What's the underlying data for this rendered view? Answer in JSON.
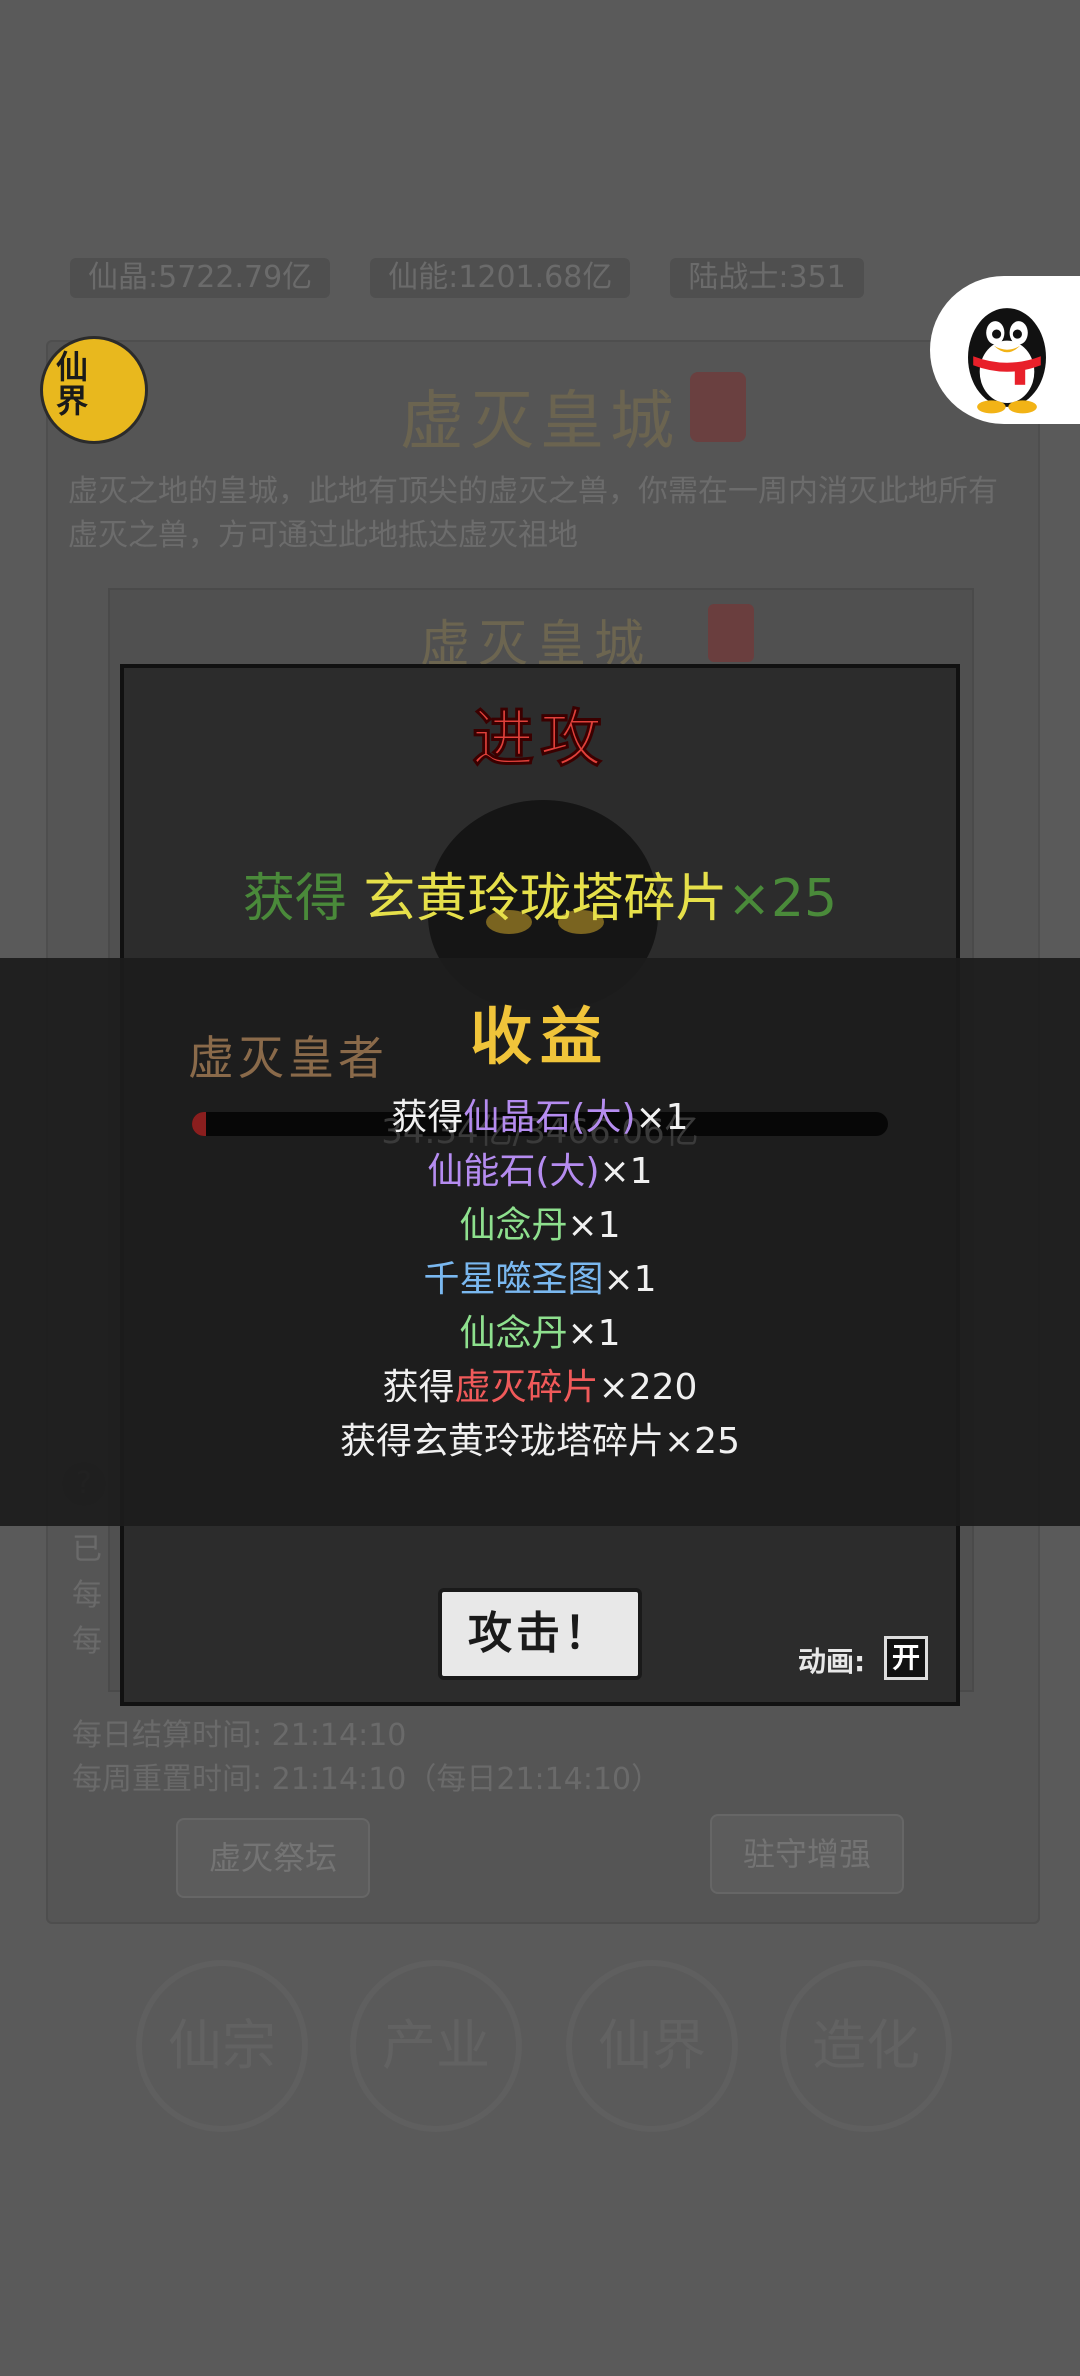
{
  "resources": [
    "仙晶:5722.79亿",
    "仙能:1201.68亿",
    "陆战士:351"
  ],
  "background": {
    "title": "虚灭皇城",
    "description": "虚灭之地的皇城，此地有顶尖的虚灭之兽，你需在一周内消灭此地所有虚灭之兽，方可通过此地抵达虚灭祖地",
    "inner_title": "虚灭皇城",
    "boss_name": "虚灭皇者",
    "boss_hp_text": "34.34亿/3466.06亿",
    "notes": [
      "已",
      "每",
      "每"
    ],
    "daily_settle": "每日结算时间: 21:14:10",
    "weekly_reset": "每周重置时间: 21:14:10（每日21:14:10）",
    "left_button": "虚灭祭坛",
    "right_button": "驻守增强",
    "help": "?",
    "nav": [
      "仙宗",
      "产业",
      "仙界",
      "造化"
    ]
  },
  "badge_label": "仙界",
  "modal": {
    "title": "进攻",
    "reward_prefix": "获得",
    "reward_item": "玄黄玲珑塔碎片",
    "reward_qty": "×25",
    "attack_button": "攻击！",
    "anim_label": "动画:",
    "anim_toggle": "开"
  },
  "income": {
    "title": "收益",
    "lines": [
      {
        "prefix": "获得",
        "item": "仙晶石(大)",
        "qty": "×1",
        "color": "#b58cf0"
      },
      {
        "prefix": "",
        "item": "仙能石(大)",
        "qty": "×1",
        "color": "#b58cf0"
      },
      {
        "prefix": "",
        "item": "仙念丹",
        "qty": "×1",
        "color": "#8ee08e"
      },
      {
        "prefix": "",
        "item": "千星噬圣图",
        "qty": "×1",
        "color": "#7ab8f0"
      },
      {
        "prefix": "",
        "item": "仙念丹",
        "qty": "×1",
        "color": "#8ee08e"
      },
      {
        "prefix": "获得",
        "item": "虚灭碎片",
        "qty": "×220",
        "color": "#f05a5a"
      },
      {
        "prefix": "获得",
        "item": "玄黄玲珑塔碎片",
        "qty": "×25",
        "color": "#f0f0f0"
      }
    ]
  }
}
